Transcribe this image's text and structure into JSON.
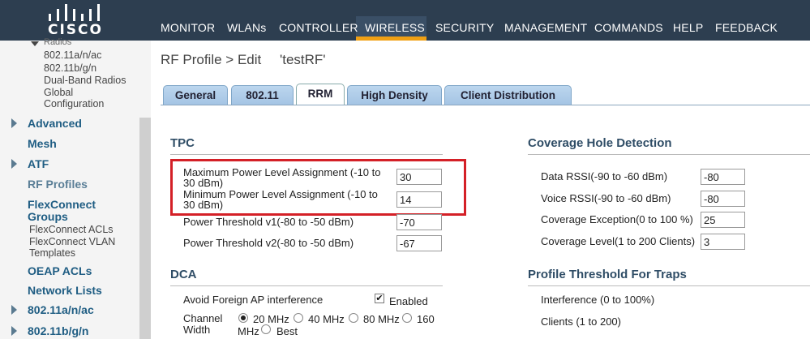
{
  "brand": {
    "name": "CISCO",
    "colors": {
      "topbar": "#2d3e50",
      "active_underline": "#f0a014",
      "highlight": "#d42027",
      "link": "#1f5d83"
    }
  },
  "nav": {
    "monitor": "MONITOR",
    "wlans": "WLANs",
    "controller": "CONTROLLER",
    "wireless": "WIRELESS",
    "security": "SECURITY",
    "management": "MANAGEMENT",
    "commands": "COMMANDS",
    "help": "HELP",
    "feedback": "FEEDBACK",
    "active": "WIRELESS"
  },
  "sidebar": {
    "radios_truncated": "Radios",
    "sub_80211anac": "802.11a/n/ac",
    "sub_80211bgn": "802.11b/g/n",
    "sub_dual_band": "Dual-Band Radios",
    "sub_global_1": "Global",
    "sub_global_2": "Configuration",
    "advanced": "Advanced",
    "mesh": "Mesh",
    "atf": "ATF",
    "rf_profiles": "RF Profiles",
    "flexconnect_groups_1": "FlexConnect",
    "flexconnect_groups_2": "Groups",
    "flexconnect_acls": "FlexConnect ACLs",
    "flexconnect_vlan_1": "FlexConnect VLAN",
    "flexconnect_vlan_2": "Templates",
    "oeap_acls": "OEAP ACLs",
    "network_lists": "Network Lists",
    "band_a": "802.11a/n/ac",
    "band_b": "802.11b/g/n"
  },
  "page": {
    "title": "RF Profile > Edit",
    "profile_name": "'testRF'"
  },
  "tabs": {
    "general": "General",
    "dot11": "802.11",
    "rrm": "RRM",
    "high_density": "High Density",
    "client_distribution": "Client Distribution",
    "active": "RRM"
  },
  "tpc": {
    "title": "TPC",
    "max_power_label_1": "Maximum Power Level Assignment (-10 to",
    "max_power_label_2": "30 dBm)",
    "max_power_value": "30",
    "min_power_label_1": "Minimum Power Level Assignment (-10 to",
    "min_power_label_2": "30 dBm)",
    "min_power_value": "14",
    "threshold_v1_label": "Power Threshold v1(-80 to -50 dBm)",
    "threshold_v1_value": "-70",
    "threshold_v2_label": "Power Threshold v2(-80 to -50 dBm)",
    "threshold_v2_value": "-67"
  },
  "dca": {
    "title": "DCA",
    "avoid_foreign_label": "Avoid Foreign AP interference",
    "avoid_foreign_enabled": "Enabled",
    "channel_width_label_1": "Channel",
    "channel_width_label_2": "Width",
    "width_20": "20 MHz",
    "width_40": "40 MHz",
    "width_80": "80 MHz",
    "width_160_1": "160",
    "width_160_2": "MHz",
    "width_best": "Best",
    "selected_width": "20 MHz"
  },
  "coverage": {
    "title": "Coverage Hole Detection",
    "data_rssi_label": "Data RSSI(-90 to -60 dBm)",
    "data_rssi_value": "-80",
    "voice_rssi_label": "Voice RSSI(-90 to -60 dBm)",
    "voice_rssi_value": "-80",
    "exception_label": "Coverage Exception(0 to 100 %)",
    "exception_value": "25",
    "level_label": "Coverage Level(1 to 200 Clients)",
    "level_value": "3"
  },
  "traps": {
    "title": "Profile Threshold For Traps",
    "interference_label": "Interference (0 to 100%)",
    "clients_label": "Clients (1 to 200)"
  }
}
